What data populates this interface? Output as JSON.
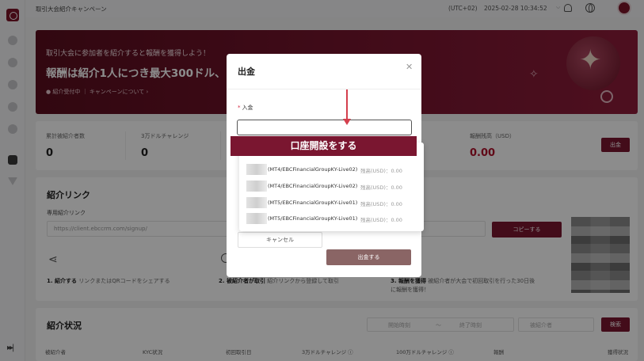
{
  "topbar": {
    "title": "取引大会紹介キャンペーン",
    "timezone": "(UTC+02)",
    "datetime": "2025-02-28 10:34:52"
  },
  "banner": {
    "subtitle": "取引大会に参加者を紹介すると報酬を獲得しよう！",
    "headline": "報酬は紹介1人につき最大300ドル、",
    "status": "紹介受付中",
    "about_link": "キャンペーンについて"
  },
  "stats": [
    {
      "label": "累計被紹介者数",
      "value": "0"
    },
    {
      "label": "3万ドルチャレンジ",
      "value": "0"
    },
    {
      "label": "報酬残高（USD）",
      "value": "0.00"
    }
  ],
  "stats_withdraw_button": "出金",
  "referral": {
    "title": "紹介リンク",
    "link_label": "専用紹介リンク",
    "link_value": "https://client.ebccrm.com/signup/",
    "copy_button": "コピーする",
    "steps": [
      {
        "num": "1. 紹介する",
        "text": "リンクまたはQRコードをシェアする"
      },
      {
        "num": "2. 被紹介者が取引",
        "text": "紹介リンクから登録して取引"
      },
      {
        "num": "3. 報酬を獲得",
        "text": "被紹介者が大会で初回取引を行った30日後"
      },
      {
        "num": "",
        "text": "に報酬を獲得！"
      }
    ]
  },
  "status_section": {
    "title": "紹介状況",
    "start_date_placeholder": "開始時刻",
    "range_sep": "～",
    "end_date_placeholder": "終了時刻",
    "search_placeholder": "被紹介者",
    "search_button": "検索",
    "columns": [
      "被紹介者",
      "KYC状況",
      "初回取引日",
      "3万ドルチャレンジ ⓘ",
      "100万ドルチャレンジ ⓘ",
      "報酬",
      "獲得状況"
    ]
  },
  "modal": {
    "title": "出金",
    "field_label": "入金",
    "required_mark": "*",
    "cancel_button": "キャンセル",
    "submit_button": "出金する"
  },
  "dropdown": {
    "options": [
      {
        "account": "(MT4/EBCFinancialGroupKY-Live02)",
        "balance_label": "残高(USD)：",
        "balance": "0.00"
      },
      {
        "account": "(MT4/EBCFinancialGroupKY-Live02)",
        "balance_label": "残高(USD)：",
        "balance": "0.00"
      },
      {
        "account": "(MT5/EBCFinancialGroupKY-Live01)",
        "balance_label": "残高(USD)：",
        "balance": "0.00"
      },
      {
        "account": "(MT5/EBCFinancialGroupKY-Live01)",
        "balance_label": "残高(USD)：",
        "balance": "0.00"
      }
    ]
  },
  "annotation": {
    "callout": "口座開設をする"
  },
  "colors": {
    "brand": "#7a1630",
    "annotation_red": "#d43f4d",
    "submit_disabled": "#8a6565"
  }
}
